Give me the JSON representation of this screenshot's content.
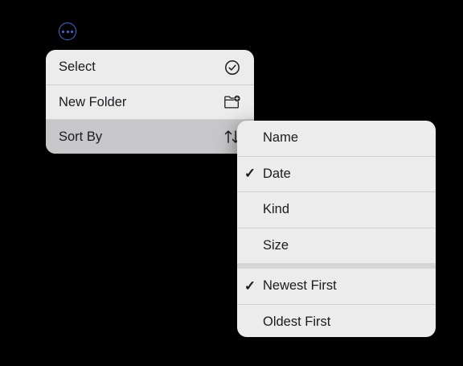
{
  "toolbar": {
    "more_icon": "ellipsis-circle-icon",
    "accent_color": "#2f73e0"
  },
  "main_menu": {
    "items": [
      {
        "label": "Select",
        "icon": "checkmark-circle-icon"
      },
      {
        "label": "New Folder",
        "icon": "folder-plus-icon"
      },
      {
        "label": "Sort By",
        "icon": "arrow-up-down-icon",
        "highlighted": true
      }
    ]
  },
  "sort_menu": {
    "sort_fields": [
      {
        "label": "Name",
        "checked": false
      },
      {
        "label": "Date",
        "checked": true
      },
      {
        "label": "Kind",
        "checked": false
      },
      {
        "label": "Size",
        "checked": false
      }
    ],
    "sort_orders": [
      {
        "label": "Newest First",
        "checked": true
      },
      {
        "label": "Oldest First",
        "checked": false
      }
    ],
    "check_glyph": "✓"
  }
}
